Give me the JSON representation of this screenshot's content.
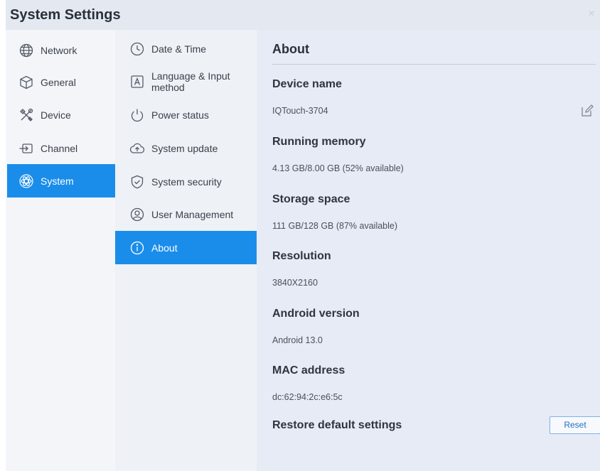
{
  "window": {
    "title": "System Settings",
    "close_label": "×"
  },
  "categories": [
    {
      "label": "Network",
      "icon": "globe-icon",
      "active": false
    },
    {
      "label": "General",
      "icon": "cube-icon",
      "active": false
    },
    {
      "label": "Device",
      "icon": "tools-icon",
      "active": false
    },
    {
      "label": "Channel",
      "icon": "input-icon",
      "active": false
    },
    {
      "label": "System",
      "icon": "atom-icon",
      "active": true
    }
  ],
  "subitems": [
    {
      "label": "Date & Time",
      "icon": "clock-icon",
      "active": false
    },
    {
      "label": "Language & Input method",
      "icon": "keyboard-icon",
      "active": false
    },
    {
      "label": "Power status",
      "icon": "power-icon",
      "active": false
    },
    {
      "label": "System update",
      "icon": "cloud-upload-icon",
      "active": false
    },
    {
      "label": "System security",
      "icon": "shield-icon",
      "active": false
    },
    {
      "label": "User Management",
      "icon": "user-icon",
      "active": false
    },
    {
      "label": "About",
      "icon": "info-icon",
      "active": true
    }
  ],
  "about": {
    "heading": "About",
    "device_name_title": "Device name",
    "device_name": "IQTouch-3704",
    "memory_title": "Running memory",
    "memory": "4.13 GB/8.00 GB (52% available)",
    "storage_title": "Storage space",
    "storage": "111 GB/128 GB (87% available)",
    "resolution_title": "Resolution",
    "resolution": "3840X2160",
    "android_title": "Android version",
    "android": "Android 13.0",
    "mac_title": "MAC address",
    "mac": "dc:62:94:2c:e6:5c",
    "restore_title": "Restore default settings",
    "reset_label": "Reset"
  },
  "colors": {
    "accent": "#1a8dea",
    "content_bg": "#e6ebf5",
    "titlebar_bg": "#e4e8f0"
  }
}
